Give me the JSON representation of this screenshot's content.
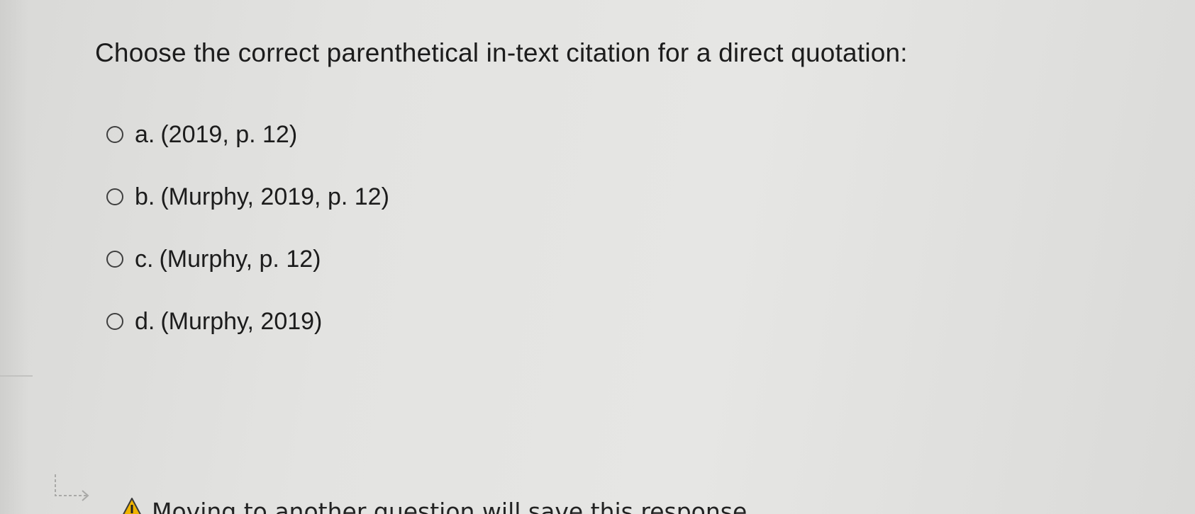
{
  "question": {
    "text": "Choose the correct parenthetical in-text citation for a direct quotation:"
  },
  "options": [
    {
      "letter": "a.",
      "text": "(2019, p. 12)"
    },
    {
      "letter": "b.",
      "text": "(Murphy, 2019, p. 12)"
    },
    {
      "letter": "c.",
      "text": "(Murphy, p. 12)"
    },
    {
      "letter": "d.",
      "text": "(Murphy, 2019)"
    }
  ],
  "notice": {
    "text": "Moving to another question will save this response."
  },
  "colors": {
    "background": "#e3e3e1",
    "text": "#1c1c1c",
    "warning": "#f0b400"
  },
  "icons": {
    "arrow": "return-arrow-icon",
    "warning": "warning-triangle-icon"
  }
}
